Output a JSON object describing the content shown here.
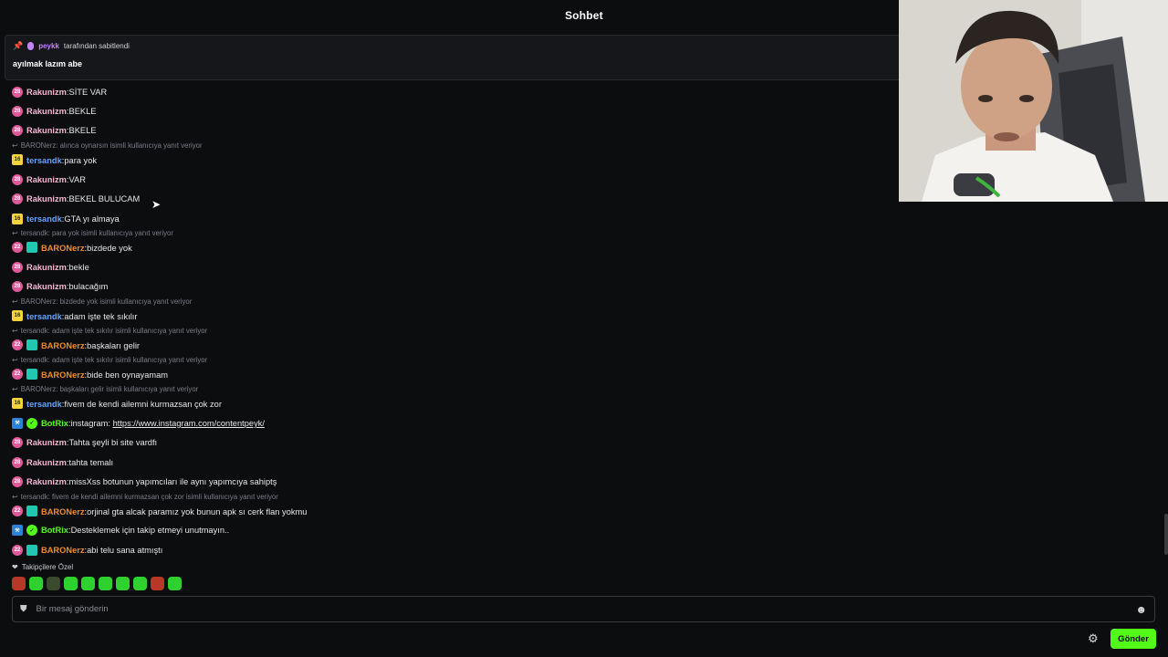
{
  "header": {
    "title": "Sohbet"
  },
  "pinned": {
    "author": "peykk",
    "label": "tarafından sabitlendi",
    "text": "ayılmak lazım abe"
  },
  "colors": {
    "accent": "#53fc18",
    "rakunizm": "#f7b6d2",
    "tersandk": "#5ea4ff",
    "baronerz": "#f08c22",
    "botrix": "#53fc18"
  },
  "messages": [
    {
      "reply": "",
      "badges": [
        "pink:28"
      ],
      "user": "Rakunizm",
      "color": "#f7b6d2",
      "text": "SİTE VAR"
    },
    {
      "reply": "",
      "badges": [
        "pink:28"
      ],
      "user": "Rakunizm",
      "color": "#f7b6d2",
      "text": "BEKLE"
    },
    {
      "reply": "",
      "badges": [
        "pink:28"
      ],
      "user": "Rakunizm",
      "color": "#f7b6d2",
      "text": "BKELE"
    },
    {
      "reply": "BARONerz: alınca oynarsın isimli kullanıcıya yanıt veriyor",
      "badges": [
        "yellow:16"
      ],
      "user": "tersandk",
      "color": "#5ea4ff",
      "text": "para yok"
    },
    {
      "reply": "",
      "badges": [
        "pink:28"
      ],
      "user": "Rakunizm",
      "color": "#f7b6d2",
      "text": "VAR"
    },
    {
      "reply": "",
      "badges": [
        "pink:28"
      ],
      "user": "Rakunizm",
      "color": "#f7b6d2",
      "text": "BEKEL BULUCAM"
    },
    {
      "reply": "",
      "badges": [
        "yellow:16"
      ],
      "user": "tersandk",
      "color": "#5ea4ff",
      "text": "GTA yı almaya"
    },
    {
      "reply": "tersandk: para yok isimli kullanıcıya yanıt veriyor",
      "badges": [
        "pink:22",
        "teal:"
      ],
      "user": "BARONerz",
      "color": "#f08c22",
      "text": "bizdede yok"
    },
    {
      "reply": "",
      "badges": [
        "pink:28"
      ],
      "user": "Rakunizm",
      "color": "#f7b6d2",
      "text": "bekle"
    },
    {
      "reply": "",
      "badges": [
        "pink:28"
      ],
      "user": "Rakunizm",
      "color": "#f7b6d2",
      "text": "bulacağım"
    },
    {
      "reply": "BARONerz: bizdede yok isimli kullanıcıya yanıt veriyor",
      "badges": [
        "yellow:16"
      ],
      "user": "tersandk",
      "color": "#5ea4ff",
      "text": "adam işte tek sıkılır"
    },
    {
      "reply": "tersandk: adam işte tek sıkılır isimli kullanıcıya yanıt veriyor",
      "badges": [
        "pink:22",
        "teal:"
      ],
      "user": "BARONerz",
      "color": "#f08c22",
      "text": "başkaları gelir"
    },
    {
      "reply": "tersandk: adam işte tek sıkılır isimli kullanıcıya yanıt veriyor",
      "badges": [
        "pink:22",
        "teal:"
      ],
      "user": "BARONerz",
      "color": "#f08c22",
      "text": "bide ben oynayamam"
    },
    {
      "reply": "BARONerz: başkaları gelir isimli kullanıcıya yanıt veriyor",
      "badges": [
        "yellow:16"
      ],
      "user": "tersandk",
      "color": "#5ea4ff",
      "text": "fivem de kendi ailemni kurmazsan çok zor"
    },
    {
      "reply": "",
      "badges": [
        "blue:",
        "check:"
      ],
      "user": "BotRix",
      "color": "#53fc18",
      "text": "instagram: ",
      "link": "https://www.instagram.com/contentpeyk/"
    },
    {
      "reply": "",
      "badges": [
        "pink:28"
      ],
      "user": "Rakunizm",
      "color": "#f7b6d2",
      "text": "Tahta şeyli bi site vardfı"
    },
    {
      "reply": "",
      "badges": [
        "pink:28"
      ],
      "user": "Rakunizm",
      "color": "#f7b6d2",
      "text": "tahta temalı"
    },
    {
      "reply": "",
      "badges": [
        "pink:28"
      ],
      "user": "Rakunizm",
      "color": "#f7b6d2",
      "text": "missXss botunun yapımcıları ile aynı yapımcıya sahiptş"
    },
    {
      "reply": "tersandk: fivem de kendi ailemni kurmazsan çok zor isimli kullanıcıya yanıt veriyor",
      "badges": [
        "pink:22",
        "teal:"
      ],
      "user": "BARONerz",
      "color": "#f08c22",
      "text": "orjinal gta alcak paramız yok bunun apk sı cerk flan yokmu"
    },
    {
      "reply": "",
      "badges": [
        "blue:",
        "check:"
      ],
      "user": "BotRix",
      "color": "#53fc18",
      "text": "Desteklemek için takip etmeyi unutmayın.."
    },
    {
      "reply": "",
      "badges": [
        "pink:22",
        "teal:"
      ],
      "user": "BARONerz",
      "color": "#f08c22",
      "text": "abi telu sana atmıştı"
    }
  ],
  "followers_label": "Takipçilere Özel",
  "composer": {
    "placeholder": "Bir mesaj gönderin"
  },
  "send_label": "Gönder"
}
